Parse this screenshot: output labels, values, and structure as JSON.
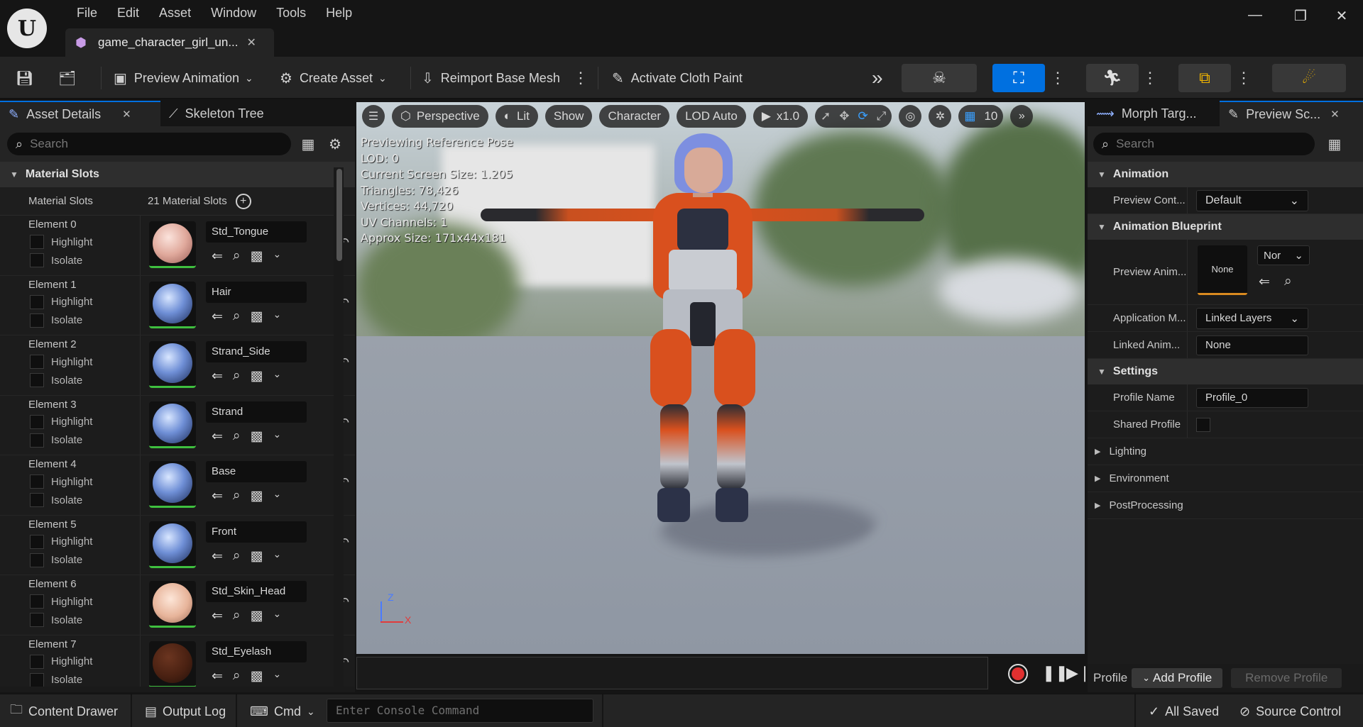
{
  "window": {
    "logo": "U",
    "menu": [
      "File",
      "Edit",
      "Asset",
      "Window",
      "Tools",
      "Help"
    ],
    "doc_tab": "game_character_girl_un...",
    "controls": {
      "minimize": "—",
      "restore": "❐",
      "close": "✕"
    }
  },
  "toolbar": {
    "preview_animation": "Preview Animation",
    "create_asset": "Create Asset",
    "reimport": "Reimport Base Mesh",
    "cloth_paint": "Activate Cloth Paint",
    "overflow": "»"
  },
  "left_panel": {
    "tabs": [
      "Asset Details",
      "Skeleton Tree"
    ],
    "search_placeholder": "Search",
    "section": "Material Slots",
    "slots_label": "Material Slots",
    "slots_count": "21 Material Slots",
    "highlight_label": "Highlight",
    "isolate_label": "Isolate",
    "elements": [
      {
        "name": "Element 0",
        "material": "Std_Tongue",
        "thumb": "skin-pink"
      },
      {
        "name": "Element 1",
        "material": "Hair",
        "thumb": "blue-hair"
      },
      {
        "name": "Element 2",
        "material": "Strand_Side",
        "thumb": "blue-hair"
      },
      {
        "name": "Element 3",
        "material": "Strand",
        "thumb": "blue-hair"
      },
      {
        "name": "Element 4",
        "material": "Base",
        "thumb": "blue-hair"
      },
      {
        "name": "Element 5",
        "material": "Front",
        "thumb": "blue-hair"
      },
      {
        "name": "Element 6",
        "material": "Std_Skin_Head",
        "thumb": "face"
      },
      {
        "name": "Element 7",
        "material": "Std_Eyelash",
        "thumb": "dark-brown"
      }
    ]
  },
  "viewport": {
    "perspective": "Perspective",
    "lit": "Lit",
    "show": "Show",
    "character": "Character",
    "lod": "LOD Auto",
    "speed": "x1.0",
    "grid_value": "10",
    "stats": [
      "Previewing Reference Pose",
      "LOD: 0",
      "Current Screen Size: 1.205",
      "Triangles: 78,426",
      "Vertices: 44,720",
      "UV Channels: 1",
      "Approx Size: 171x44x181"
    ],
    "axis_z": "Z",
    "axis_x": "X"
  },
  "right_panel": {
    "tabs": [
      "Morph Targ...",
      "Preview Sc..."
    ],
    "search_placeholder": "Search",
    "animation_section": "Animation",
    "preview_controller_label": "Preview Cont...",
    "preview_controller_value": "Default",
    "blueprint_section": "Animation Blueprint",
    "preview_anim_label": "Preview Anim...",
    "preview_anim_thumb": "None",
    "preview_anim_dropdown": "Nor",
    "application_mode_label": "Application M...",
    "application_mode_value": "Linked Layers",
    "linked_anim_label": "Linked Anim...",
    "linked_anim_value": "None",
    "settings_section": "Settings",
    "profile_name_label": "Profile Name",
    "profile_name_value": "Profile_0",
    "shared_profile_label": "Shared Profile",
    "collapsed": [
      "Lighting",
      "Environment",
      "PostProcessing"
    ],
    "footer_label": "Profile",
    "add_profile": "Add Profile",
    "remove_profile": "Remove Profile"
  },
  "statusbar": {
    "content_drawer": "Content Drawer",
    "output_log": "Output Log",
    "cmd": "Cmd",
    "console_placeholder": "Enter Console Command",
    "saved": "All Saved",
    "source_control": "Source Control"
  },
  "colors": {
    "accent_blue": "#0070e0",
    "suit_orange": "#d9501e",
    "hair_blue": "#7d8fe0",
    "record_red": "#e03030"
  }
}
